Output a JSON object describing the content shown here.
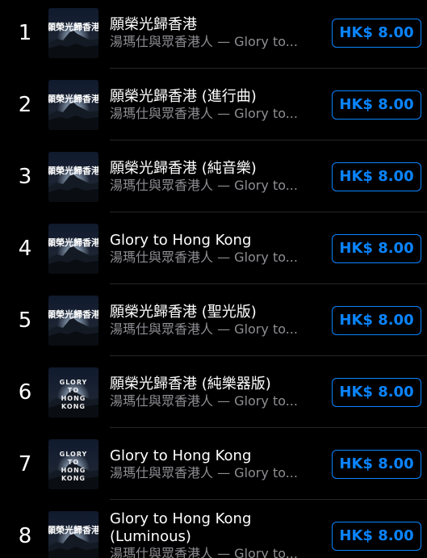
{
  "tracks": [
    {
      "rank": "1",
      "title": "願榮光歸香港",
      "subtitle": "湯瑪仕與眾香港人 — Glory to...",
      "price": "HK$ 8.00",
      "art": "photo-calligraphy"
    },
    {
      "rank": "2",
      "title": "願榮光歸香港 (進行曲)",
      "subtitle": "湯瑪仕與眾香港人 — Glory to...",
      "price": "HK$ 8.00",
      "art": "photo-calligraphy"
    },
    {
      "rank": "3",
      "title": "願榮光歸香港 (純音樂)",
      "subtitle": "湯瑪仕與眾香港人 — Glory to...",
      "price": "HK$ 8.00",
      "art": "photo-calligraphy"
    },
    {
      "rank": "4",
      "title": "Glory to Hong Kong",
      "subtitle": "湯瑪仕與眾香港人 — Glory to...",
      "price": "HK$ 8.00",
      "art": "photo-calligraphy"
    },
    {
      "rank": "5",
      "title": "願榮光歸香港 (聖光版)",
      "subtitle": "湯瑪仕與眾香港人 — Glory to...",
      "price": "HK$ 8.00",
      "art": "photo-calligraphy"
    },
    {
      "rank": "6",
      "title": "願榮光歸香港 (純樂器版)",
      "subtitle": "湯瑪仕與眾香港人 — Glory to...",
      "price": "HK$ 8.00",
      "art": "photo-text",
      "art_text": "GLORY\nTO\nHONG\nKONG"
    },
    {
      "rank": "7",
      "title": "Glory to Hong Kong",
      "subtitle": "湯瑪仕與眾香港人 — Glory to...",
      "price": "HK$ 8.00",
      "art": "photo-text",
      "art_text": "GLORY\nTO\nHONG\nKONG"
    },
    {
      "rank": "8",
      "title": "Glory to Hong Kong (Luminous)",
      "subtitle": "湯瑪仕與眾香港人 — Glory to...",
      "price": "HK$ 8.00",
      "art": "photo-calligraphy"
    }
  ],
  "colors": {
    "accent": "#0a84ff",
    "background": "#000000",
    "secondary_text": "#8e8e93",
    "separator": "#262628"
  }
}
